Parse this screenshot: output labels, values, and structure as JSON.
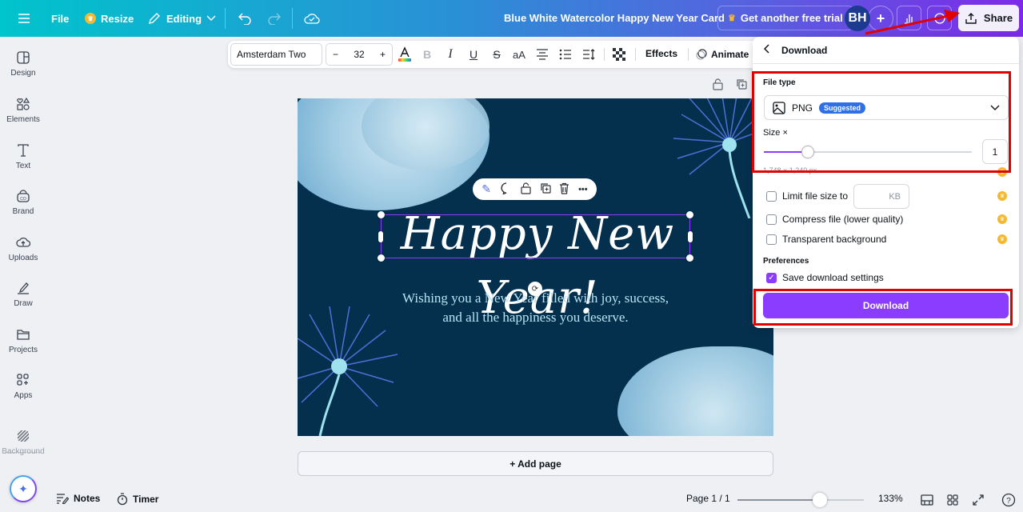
{
  "topbar": {
    "menu_icon": "hamburger-icon",
    "file_label": "File",
    "resize_label": "Resize",
    "editing_label": "Editing",
    "doc_title": "Blue White Watercolor Happy New Year  Card",
    "trial_label": "Get another free trial",
    "avatar_initials": "BH",
    "add_label": "+",
    "share_label": "Share",
    "icons": [
      "undo-icon",
      "redo-icon",
      "cloud-saved-icon",
      "analytics-icon",
      "comment-icon",
      "share-upload-icon"
    ]
  },
  "sidebar": {
    "items": [
      {
        "label": "Design",
        "icon": "design-icon"
      },
      {
        "label": "Elements",
        "icon": "elements-icon"
      },
      {
        "label": "Text",
        "icon": "text-icon"
      },
      {
        "label": "Brand",
        "icon": "brand-icon"
      },
      {
        "label": "Uploads",
        "icon": "uploads-icon"
      },
      {
        "label": "Draw",
        "icon": "draw-icon"
      },
      {
        "label": "Projects",
        "icon": "projects-icon"
      },
      {
        "label": "Apps",
        "icon": "apps-icon"
      },
      {
        "label": "Background",
        "icon": "background-icon"
      }
    ],
    "magic_icon": "sparkle-icon"
  },
  "text_toolbar": {
    "font_name": "Amsterdam Two",
    "decrease": "−",
    "font_size": "32",
    "increase": "+",
    "bold": "B",
    "italic": "I",
    "underline": "U",
    "strike": "S",
    "case": "aA",
    "effects_label": "Effects",
    "animate_label": "Animate"
  },
  "canvas": {
    "heading": "Happy New Year!",
    "subtext_line1": "Wishing you a New Year filled with joy, success,",
    "subtext_line2": "and all the happiness you deserve.",
    "context_menu_icons": [
      "magic-edit-icon",
      "add-comment-icon",
      "lock-icon",
      "duplicate-icon",
      "delete-icon",
      "more-icon"
    ],
    "more_label": "•••"
  },
  "add_page_label": "+ Add page",
  "bottom_bar": {
    "notes_label": "Notes",
    "timer_label": "Timer",
    "page_label": "Page 1 / 1",
    "zoom_label": "133%",
    "zoom_fraction": 0.65
  },
  "download_panel": {
    "title": "Download",
    "file_type_label": "File type",
    "file_type_value": "PNG",
    "suggested_badge": "Suggested",
    "size_label": "Size ×",
    "size_value": "1",
    "size_fraction": 0.21,
    "dimensions": "1,748 × 1,240 px",
    "limit_label": "Limit file size to",
    "kb_placeholder": "KB",
    "compress_label": "Compress file (lower quality)",
    "transparent_label": "Transparent background",
    "preferences_label": "Preferences",
    "save_settings_label": "Save download settings",
    "save_settings_checked": true,
    "download_button": "Download"
  },
  "colors": {
    "accent": "#8b3dff",
    "badge": "#2f6fe8",
    "crown": "#f5b82e",
    "annotation": "#e00000",
    "canvas_bg": "#05304d"
  }
}
